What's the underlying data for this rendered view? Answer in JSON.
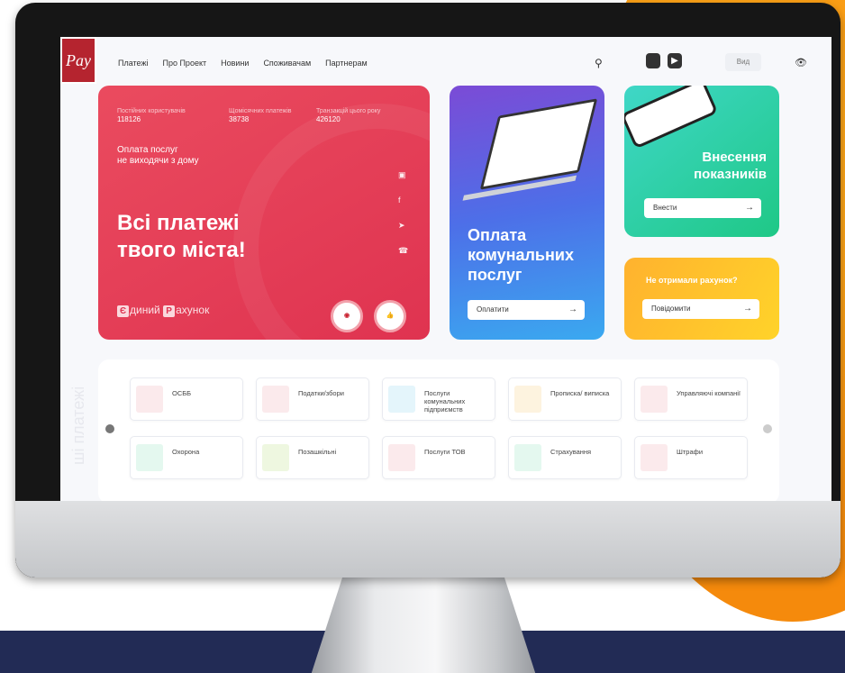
{
  "nav": {
    "items": [
      "Платежі",
      "Про Проект",
      "Новини",
      "Споживачам",
      "Партнерам"
    ],
    "logo": "Pay",
    "vid": "Вид"
  },
  "hero": {
    "stats": [
      {
        "label": "Постійних користувачів",
        "value": "118126"
      },
      {
        "label": "Щомісячних платежів",
        "value": "38738"
      },
      {
        "label": "Транзакцій цього року",
        "value": "426120"
      }
    ],
    "sub_line1": "Оплата послуг",
    "sub_line2": "не виходячи з дому",
    "title_line1": "Всі платежі",
    "title_line2": "твого міста!",
    "brand_e": "Є",
    "brand_word1": "диний",
    "brand_r": "Р",
    "brand_word2": "ахунок"
  },
  "card_utilities": {
    "title_line1": "Оплата",
    "title_line2": "комунальних",
    "title_line3": "послуг",
    "button": "Оплатити"
  },
  "card_meters": {
    "title_line1": "Внесення",
    "title_line2": "показників",
    "button": "Внести"
  },
  "card_bill": {
    "question": "Не отримали рахунок?",
    "button": "Повідомити"
  },
  "categories": {
    "side_label": "ші платежі",
    "row1": [
      "ОСББ",
      "Податки/збори",
      "Послуги комунальних підприємств",
      "Прописка/ виписка",
      "Управляючі компанії"
    ],
    "row2": [
      "Охорона",
      "Позашкільні",
      "Послуги ТОВ",
      "Страхування",
      "Штрафи"
    ]
  },
  "colors": {
    "hero": "#df3350",
    "utilities": "#4d6fe8",
    "meters": "#1fc886",
    "bill": "#ffc22a",
    "orange_bg": "#f58a0c",
    "navy_band": "#222b55"
  }
}
